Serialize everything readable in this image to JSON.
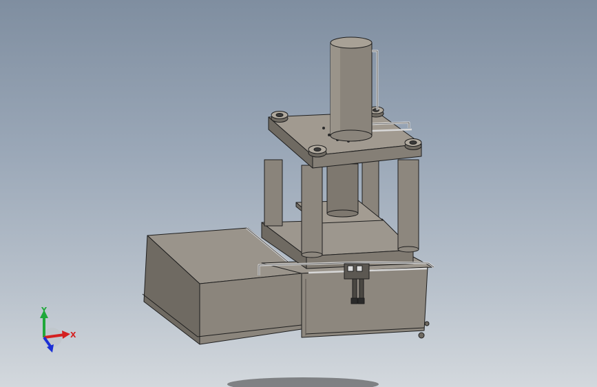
{
  "viewport": {
    "background_top": "#7f8ea0",
    "background_bottom": "#d3d8dd"
  },
  "model": {
    "body_color": "#8d877e",
    "shade_color": "#6f6a62",
    "light_color": "#a39c92",
    "edge_color": "#1e1e1e",
    "rail_color": "#d8d8d8"
  },
  "triad": {
    "x_label": "X",
    "y_label": "Y",
    "x_color": "#d42020",
    "y_color": "#1fa83a",
    "z_color": "#1a2fd6"
  }
}
